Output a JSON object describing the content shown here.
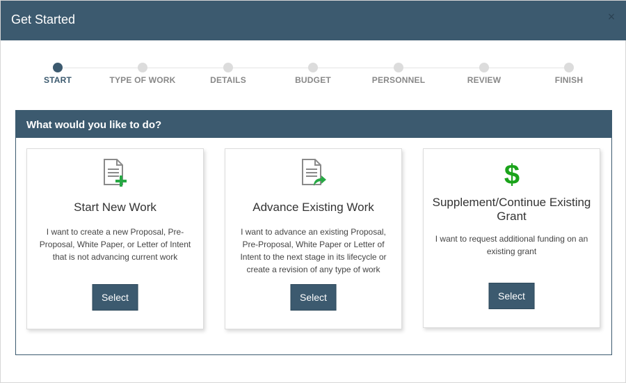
{
  "dialog": {
    "title": "Get Started",
    "close_glyph": "×"
  },
  "stepper": {
    "steps": [
      {
        "label": "START",
        "active": true
      },
      {
        "label": "TYPE OF WORK",
        "active": false
      },
      {
        "label": "DETAILS",
        "active": false
      },
      {
        "label": "BUDGET",
        "active": false
      },
      {
        "label": "PERSONNEL",
        "active": false
      },
      {
        "label": "REVIEW",
        "active": false
      },
      {
        "label": "FINISH",
        "active": false
      }
    ]
  },
  "panel": {
    "heading": "What would you like to do?",
    "cards": [
      {
        "icon": "document-add-icon",
        "title": "Start New Work",
        "description": "I want to create a new Proposal, Pre-Proposal, White Paper, or Letter of Intent that is not advancing current work",
        "button_label": "Select"
      },
      {
        "icon": "document-forward-icon",
        "title": "Advance Existing Work",
        "description": "I want to advance an existing Proposal, Pre-Proposal, White Paper or Letter of Intent to the next stage in its lifecycle or create a revision of any type of work",
        "button_label": "Select"
      },
      {
        "icon": "dollar-icon",
        "title": "Supplement/Continue Existing Grant",
        "description": "I want to request additional funding on an existing grant",
        "button_label": "Select"
      }
    ]
  },
  "colors": {
    "header": "#3c5a6f",
    "accent_green": "#27a844",
    "dollar_green": "#1aa31a"
  }
}
